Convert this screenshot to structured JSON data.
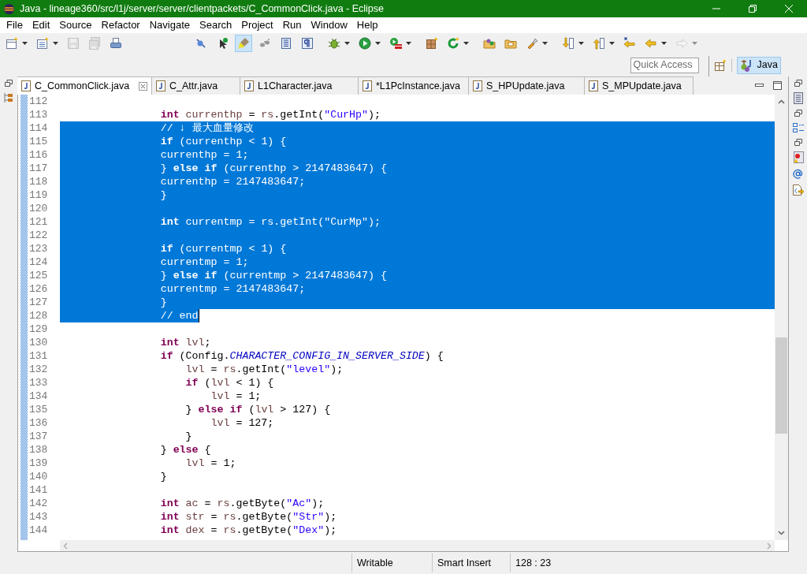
{
  "window": {
    "title": "Java - lineage360/src/l1j/server/server/clientpackets/C_CommonClick.java - Eclipse"
  },
  "menu": [
    "File",
    "Edit",
    "Source",
    "Refactor",
    "Navigate",
    "Search",
    "Project",
    "Run",
    "Window",
    "Help"
  ],
  "toolbar": [
    [
      {
        "dropdown": true,
        "disabled": false,
        "pressed": false
      },
      {
        "dropdown": true,
        "disabled": false,
        "pressed": false
      },
      {
        "dropdown": false,
        "disabled": true,
        "pressed": false
      },
      {
        "dropdown": false,
        "disabled": true,
        "pressed": false
      },
      {
        "dropdown": false,
        "disabled": false,
        "pressed": false
      }
    ],
    [
      {
        "dropdown": false,
        "disabled": false,
        "pressed": false
      },
      {
        "dropdown": false,
        "disabled": false,
        "pressed": false
      },
      {
        "dropdown": false,
        "disabled": false,
        "pressed": true
      },
      {
        "dropdown": false,
        "disabled": false,
        "pressed": false
      },
      {
        "dropdown": false,
        "disabled": false,
        "pressed": false
      },
      {
        "dropdown": false,
        "disabled": false,
        "pressed": false
      }
    ],
    [
      {
        "dropdown": true,
        "disabled": false,
        "pressed": false
      },
      {
        "dropdown": true,
        "disabled": false,
        "pressed": false
      },
      {
        "dropdown": true,
        "disabled": false,
        "pressed": false
      }
    ],
    [
      {
        "dropdown": false,
        "disabled": false,
        "pressed": false
      },
      {
        "dropdown": true,
        "disabled": false,
        "pressed": false
      }
    ],
    [
      {
        "dropdown": false,
        "disabled": false,
        "pressed": false
      },
      {
        "dropdown": false,
        "disabled": false,
        "pressed": false
      },
      {
        "dropdown": true,
        "disabled": false,
        "pressed": false
      }
    ],
    [
      {
        "dropdown": true,
        "disabled": false,
        "pressed": false
      },
      {
        "dropdown": true,
        "disabled": false,
        "pressed": false
      },
      {
        "dropdown": false,
        "disabled": false,
        "pressed": false
      },
      {
        "dropdown": true,
        "disabled": false,
        "pressed": false
      },
      {
        "dropdown": true,
        "disabled": true,
        "pressed": false
      }
    ]
  ],
  "quick_access": {
    "placeholder": "Quick Access"
  },
  "perspectives": [
    {
      "label": "Java",
      "selected": true
    }
  ],
  "tabs": [
    {
      "label": "C_CommonClick.java",
      "selected": true
    },
    {
      "label": "C_Attr.java",
      "selected": false
    },
    {
      "label": "L1Character.java",
      "selected": false
    },
    {
      "label": "*L1PcInstance.java",
      "selected": false
    },
    {
      "label": "S_HPUpdate.java",
      "selected": false
    },
    {
      "label": "S_MPUpdate.java",
      "selected": false
    }
  ],
  "editor": {
    "lines": [
      {
        "number": "112",
        "selected": false,
        "caret": false
      },
      {
        "number": "113",
        "selected": false,
        "caret": false,
        "tokens": [
          {
            "kind": "keyword",
            "text": "                int"
          },
          {
            "kind": "local",
            "text": " currenthp"
          },
          {
            "kind": "plain",
            "text": " = "
          },
          {
            "kind": "local",
            "text": "rs"
          },
          {
            "kind": "plain",
            "text": ".getInt("
          },
          {
            "kind": "string",
            "text": "\"CurHp\""
          },
          {
            "kind": "plain",
            "text": ");"
          }
        ]
      },
      {
        "number": "114",
        "selected": true,
        "caret": false,
        "tokens": [
          {
            "kind": "comment",
            "text": "                // ↓ 最大血量修改"
          }
        ]
      },
      {
        "number": "115",
        "selected": true,
        "caret": false,
        "tokens": [
          {
            "kind": "keyword",
            "text": "                if"
          },
          {
            "kind": "plain",
            "text": " ("
          },
          {
            "kind": "local",
            "text": "currenthp"
          },
          {
            "kind": "plain",
            "text": " < 1) {"
          }
        ]
      },
      {
        "number": "116",
        "selected": true,
        "caret": false,
        "tokens": [
          {
            "kind": "local",
            "text": "                currenthp"
          },
          {
            "kind": "plain",
            "text": " = 1;"
          }
        ]
      },
      {
        "number": "117",
        "selected": true,
        "caret": false,
        "tokens": [
          {
            "kind": "plain",
            "text": "                }"
          },
          {
            "kind": "keyword",
            "text": " else"
          },
          {
            "kind": "keyword",
            "text": " if"
          },
          {
            "kind": "plain",
            "text": " ("
          },
          {
            "kind": "local",
            "text": "currenthp"
          },
          {
            "kind": "plain",
            "text": " > 2147483647) {"
          }
        ]
      },
      {
        "number": "118",
        "selected": true,
        "caret": false,
        "tokens": [
          {
            "kind": "local",
            "text": "                currenthp"
          },
          {
            "kind": "plain",
            "text": " = 2147483647;"
          }
        ]
      },
      {
        "number": "119",
        "selected": true,
        "caret": false,
        "tokens": [
          {
            "kind": "plain",
            "text": "                }"
          }
        ]
      },
      {
        "number": "120",
        "selected": true,
        "caret": false
      },
      {
        "number": "121",
        "selected": true,
        "caret": false,
        "tokens": [
          {
            "kind": "keyword",
            "text": "                int"
          },
          {
            "kind": "local",
            "text": " currentmp"
          },
          {
            "kind": "plain",
            "text": " = "
          },
          {
            "kind": "local",
            "text": "rs"
          },
          {
            "kind": "plain",
            "text": ".getInt("
          },
          {
            "kind": "string",
            "text": "\"CurMp\""
          },
          {
            "kind": "plain",
            "text": ");"
          }
        ]
      },
      {
        "number": "122",
        "selected": true,
        "caret": false
      },
      {
        "number": "123",
        "selected": true,
        "caret": false,
        "tokens": [
          {
            "kind": "keyword",
            "text": "                if"
          },
          {
            "kind": "plain",
            "text": " ("
          },
          {
            "kind": "local",
            "text": "currentmp"
          },
          {
            "kind": "plain",
            "text": " < 1) {"
          }
        ]
      },
      {
        "number": "124",
        "selected": true,
        "caret": false,
        "tokens": [
          {
            "kind": "local",
            "text": "                currentmp"
          },
          {
            "kind": "plain",
            "text": " = 1;"
          }
        ]
      },
      {
        "number": "125",
        "selected": true,
        "caret": false,
        "tokens": [
          {
            "kind": "plain",
            "text": "                }"
          },
          {
            "kind": "keyword",
            "text": " else"
          },
          {
            "kind": "keyword",
            "text": " if"
          },
          {
            "kind": "plain",
            "text": " ("
          },
          {
            "kind": "local",
            "text": "currentmp"
          },
          {
            "kind": "plain",
            "text": " > 2147483647) {"
          }
        ]
      },
      {
        "number": "126",
        "selected": true,
        "caret": false,
        "tokens": [
          {
            "kind": "local",
            "text": "                currentmp"
          },
          {
            "kind": "plain",
            "text": " = 2147483647;"
          }
        ]
      },
      {
        "number": "127",
        "selected": true,
        "caret": false,
        "tokens": [
          {
            "kind": "plain",
            "text": "                }"
          }
        ]
      },
      {
        "number": "128",
        "selected": true,
        "caret": true,
        "tokens": [
          {
            "kind": "comment",
            "text": "                // end"
          }
        ]
      },
      {
        "number": "129",
        "selected": false,
        "caret": false
      },
      {
        "number": "130",
        "selected": false,
        "caret": false,
        "tokens": [
          {
            "kind": "keyword",
            "text": "                int"
          },
          {
            "kind": "local",
            "text": " lvl"
          },
          {
            "kind": "plain",
            "text": ";"
          }
        ]
      },
      {
        "number": "131",
        "selected": false,
        "caret": false,
        "tokens": [
          {
            "kind": "keyword",
            "text": "                if"
          },
          {
            "kind": "plain",
            "text": " (Config."
          },
          {
            "kind": "static_field",
            "text": "CHARACTER_CONFIG_IN_SERVER_SIDE"
          },
          {
            "kind": "plain",
            "text": ") {"
          }
        ]
      },
      {
        "number": "132",
        "selected": false,
        "caret": false,
        "tokens": [
          {
            "kind": "local",
            "text": "                    lvl"
          },
          {
            "kind": "plain",
            "text": " = "
          },
          {
            "kind": "local",
            "text": "rs"
          },
          {
            "kind": "plain",
            "text": ".getInt("
          },
          {
            "kind": "string",
            "text": "\"level\""
          },
          {
            "kind": "plain",
            "text": ");"
          }
        ]
      },
      {
        "number": "133",
        "selected": false,
        "caret": false,
        "tokens": [
          {
            "kind": "keyword",
            "text": "                    if"
          },
          {
            "kind": "plain",
            "text": " ("
          },
          {
            "kind": "local",
            "text": "lvl"
          },
          {
            "kind": "plain",
            "text": " < 1) {"
          }
        ]
      },
      {
        "number": "134",
        "selected": false,
        "caret": false,
        "tokens": [
          {
            "kind": "local",
            "text": "                        lvl"
          },
          {
            "kind": "plain",
            "text": " = 1;"
          }
        ]
      },
      {
        "number": "135",
        "selected": false,
        "caret": false,
        "tokens": [
          {
            "kind": "plain",
            "text": "                    }"
          },
          {
            "kind": "keyword",
            "text": " else"
          },
          {
            "kind": "keyword",
            "text": " if"
          },
          {
            "kind": "plain",
            "text": " ("
          },
          {
            "kind": "local",
            "text": "lvl"
          },
          {
            "kind": "plain",
            "text": " > 127) {"
          }
        ]
      },
      {
        "number": "136",
        "selected": false,
        "caret": false,
        "tokens": [
          {
            "kind": "local",
            "text": "                        lvl"
          },
          {
            "kind": "plain",
            "text": " = 127;"
          }
        ]
      },
      {
        "number": "137",
        "selected": false,
        "caret": false,
        "tokens": [
          {
            "kind": "plain",
            "text": "                    }"
          }
        ]
      },
      {
        "number": "138",
        "selected": false,
        "caret": false,
        "tokens": [
          {
            "kind": "plain",
            "text": "                }"
          },
          {
            "kind": "keyword",
            "text": " else"
          },
          {
            "kind": "plain",
            "text": " {"
          }
        ]
      },
      {
        "number": "139",
        "selected": false,
        "caret": false,
        "tokens": [
          {
            "kind": "local",
            "text": "                    lvl"
          },
          {
            "kind": "plain",
            "text": " = 1;"
          }
        ]
      },
      {
        "number": "140",
        "selected": false,
        "caret": false,
        "tokens": [
          {
            "kind": "plain",
            "text": "                }"
          }
        ]
      },
      {
        "number": "141",
        "selected": false,
        "caret": false
      },
      {
        "number": "142",
        "selected": false,
        "caret": false,
        "tokens": [
          {
            "kind": "keyword",
            "text": "                int"
          },
          {
            "kind": "local",
            "text": " ac"
          },
          {
            "kind": "plain",
            "text": " = "
          },
          {
            "kind": "local",
            "text": "rs"
          },
          {
            "kind": "plain",
            "text": ".getByte("
          },
          {
            "kind": "string",
            "text": "\"Ac\""
          },
          {
            "kind": "plain",
            "text": ");"
          }
        ]
      },
      {
        "number": "143",
        "selected": false,
        "caret": false,
        "tokens": [
          {
            "kind": "keyword",
            "text": "                int"
          },
          {
            "kind": "local",
            "text": " str"
          },
          {
            "kind": "plain",
            "text": " = "
          },
          {
            "kind": "local",
            "text": "rs"
          },
          {
            "kind": "plain",
            "text": ".getByte("
          },
          {
            "kind": "string",
            "text": "\"Str\""
          },
          {
            "kind": "plain",
            "text": ");"
          }
        ]
      },
      {
        "number": "144",
        "selected": false,
        "caret": false,
        "tokens": [
          {
            "kind": "keyword",
            "text": "                int"
          },
          {
            "kind": "local",
            "text": " dex"
          },
          {
            "kind": "plain",
            "text": " = "
          },
          {
            "kind": "local",
            "text": "rs"
          },
          {
            "kind": "plain",
            "text": ".getByte("
          },
          {
            "kind": "string",
            "text": "\"Dex\""
          },
          {
            "kind": "plain",
            "text": ");"
          }
        ]
      }
    ]
  },
  "status_bar": [
    "Writable",
    "Smart Insert",
    "128 : 23"
  ]
}
